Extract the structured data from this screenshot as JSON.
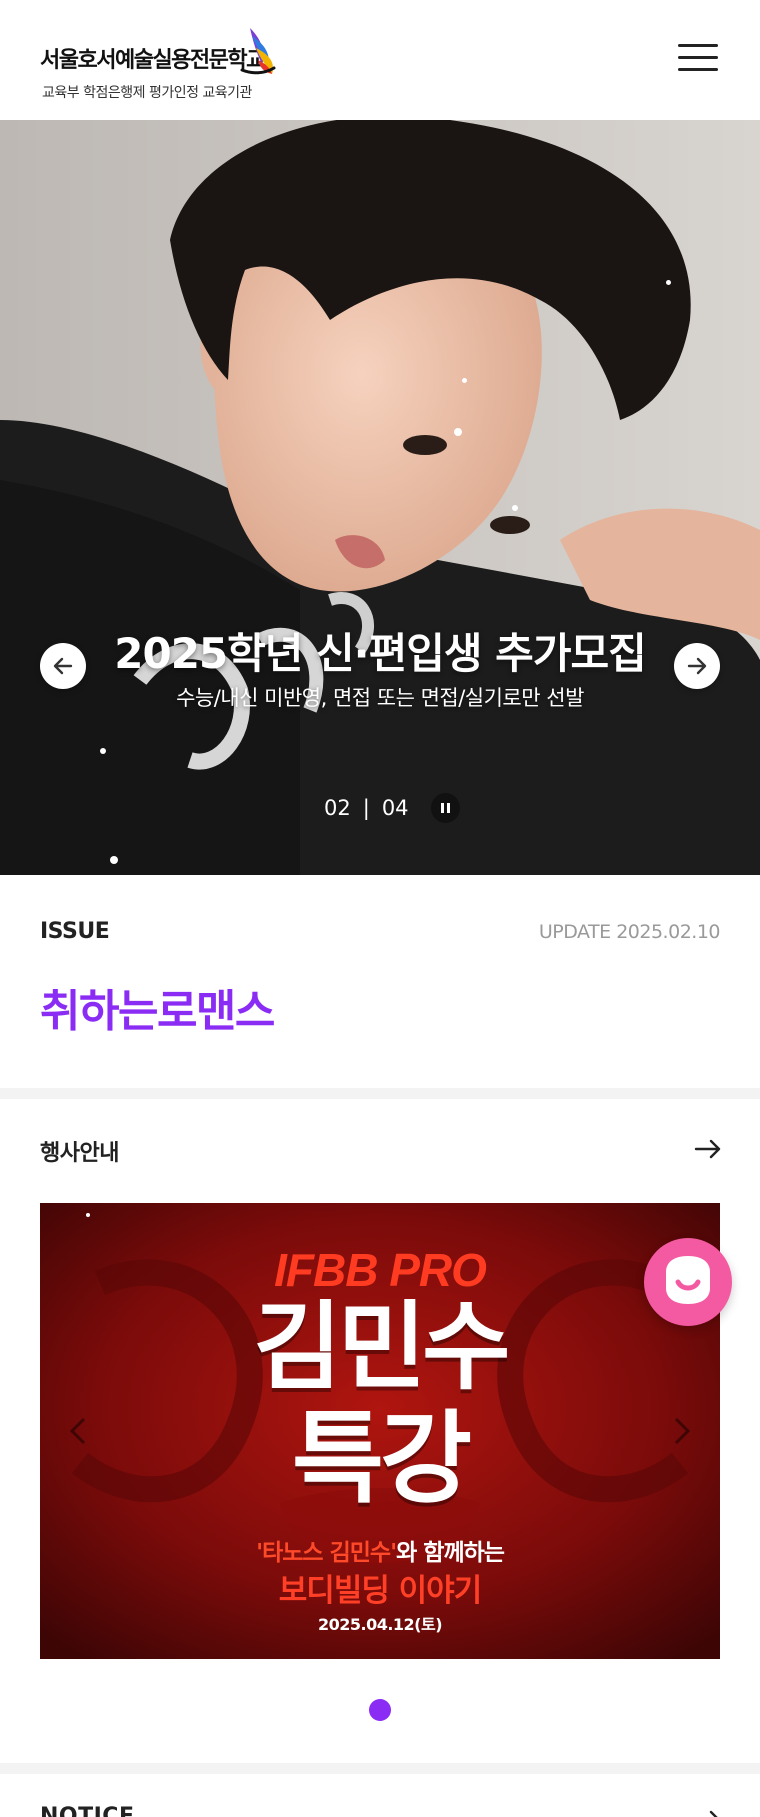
{
  "header": {
    "school_name": "서울호서예술실용전문학교",
    "school_subtitle": "교육부 학점은행제 평가인정 교육기관",
    "menu_icon": "hamburger-menu-icon"
  },
  "hero": {
    "title": "2025학년 신·편입생 추가모집",
    "subtitle": "수능/내신 미반영, 면접 또는 면접/실기로만 선발",
    "current_slide": "02",
    "separator": "|",
    "total_slides": "04",
    "prev_icon": "arrow-left-icon",
    "next_icon": "arrow-right-icon",
    "pause_icon": "pause-icon"
  },
  "issue": {
    "label": "ISSUE",
    "update": "UPDATE 2025.02.10",
    "headline": "취하는로맨스",
    "headline_color": "#8b2cf5"
  },
  "events": {
    "title": "행사안내",
    "more_icon": "arrow-right-icon",
    "poster": {
      "brand": "IFBB PRO",
      "name": "김민수",
      "lecture": "특강",
      "tagline_highlight": "'타노스 김민수'",
      "tagline_rest": "와 함께하는",
      "topic": "보디빌딩 이야기",
      "date": "2025.04.12(토)"
    },
    "pager_color": "#8b2cf5"
  },
  "chat": {
    "icon": "chat-smile-icon",
    "color": "#f45aa2"
  },
  "notice": {
    "title": "NOTICE"
  }
}
